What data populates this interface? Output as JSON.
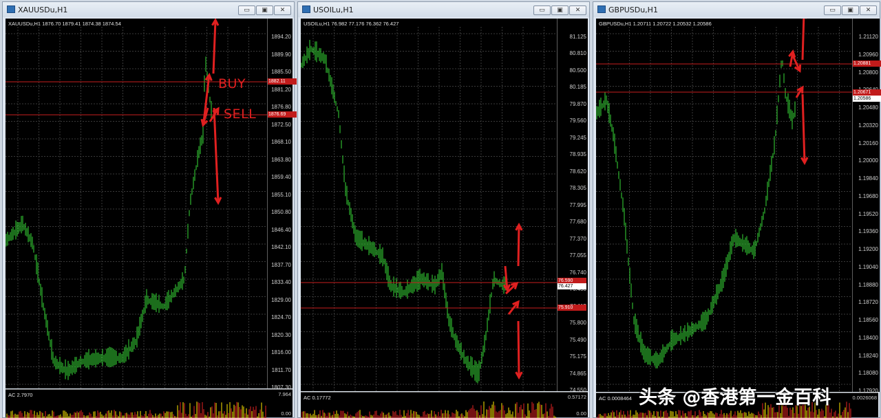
{
  "windows": [
    {
      "title": "XAUUSDu,H1",
      "header": "XAUUSDu,H1  1876.70 1879.41 1874.38 1874.54",
      "price_ticks": [
        "1894.20",
        "1889.90",
        "1885.50",
        "1881.20",
        "1876.80",
        "1872.50",
        "1868.10",
        "1863.80",
        "1859.40",
        "1855.10",
        "1850.80",
        "1846.40",
        "1842.10",
        "1837.70",
        "1833.40",
        "1829.00",
        "1824.70",
        "1820.30",
        "1816.00",
        "1811.70",
        "1807.30"
      ],
      "tags": [
        "1882.11",
        "1876.69"
      ],
      "indicator_label": "AC 2.7970",
      "indicator_values": [
        "7.964",
        "0.00"
      ],
      "annotations": {
        "buy": "BUY",
        "sell": "SELL"
      }
    },
    {
      "title": "USOILu,H1",
      "header": "USOILu,H1  76.982 77.176 76.362 76.427",
      "price_ticks": [
        "81.125",
        "80.810",
        "80.500",
        "80.185",
        "79.870",
        "79.560",
        "79.245",
        "78.935",
        "78.620",
        "78.305",
        "77.995",
        "77.680",
        "77.370",
        "77.055",
        "76.740",
        "76.430",
        "76.115",
        "75.800",
        "75.490",
        "75.175",
        "74.865",
        "74.550"
      ],
      "tags": [
        "76.590",
        "76.427",
        "75.910"
      ],
      "indicator_label": "AC 0.17772",
      "indicator_values": [
        "0.57172",
        "0.00"
      ]
    },
    {
      "title": "GBPUSDu,H1",
      "header": "GBPUSDu,H1  1.20711 1.20722 1.20532 1.20586",
      "price_ticks": [
        "1.21120",
        "1.20960",
        "1.20800",
        "1.20640",
        "1.20480",
        "1.20320",
        "1.20160",
        "1.20000",
        "1.19840",
        "1.19680",
        "1.19520",
        "1.19360",
        "1.19200",
        "1.19040",
        "1.18880",
        "1.18720",
        "1.18560",
        "1.18400",
        "1.18240",
        "1.18080",
        "1.17920"
      ],
      "tags": [
        "1.20881",
        "1.20671",
        "1.20586"
      ],
      "indicator_label": "AC 0.0008464",
      "indicator_values": [
        "0.0026068"
      ]
    }
  ],
  "window_buttons": {
    "minimize": "▭",
    "restore": "▣",
    "close": "✕"
  },
  "colors": {
    "candles": "#2fb82f",
    "lines": "#c81e1e",
    "arrows": "#e02020",
    "grid": "#3a3a3a"
  },
  "watermark": "头条 @香港第一金百科"
}
